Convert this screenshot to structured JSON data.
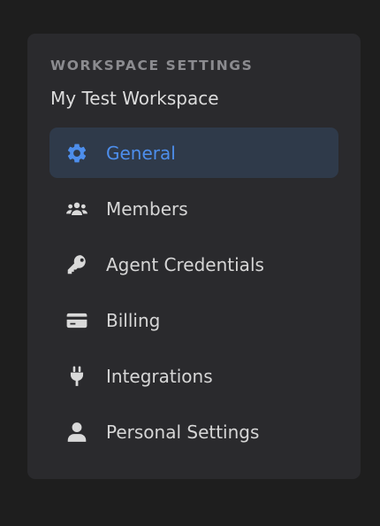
{
  "sidebar": {
    "section_label": "WORKSPACE SETTINGS",
    "workspace_name": "My Test Workspace",
    "items": [
      {
        "label": "General",
        "icon": "gear-icon",
        "active": true
      },
      {
        "label": "Members",
        "icon": "users-icon",
        "active": false
      },
      {
        "label": "Agent Credentials",
        "icon": "key-icon",
        "active": false
      },
      {
        "label": "Billing",
        "icon": "credit-card-icon",
        "active": false
      },
      {
        "label": "Integrations",
        "icon": "plug-icon",
        "active": false
      },
      {
        "label": "Personal Settings",
        "icon": "user-icon",
        "active": false
      }
    ]
  },
  "colors": {
    "background": "#1e1e1e",
    "panel": "#2a2a2d",
    "active_background": "#2f3a4a",
    "accent": "#4d8eec",
    "text": "#d6d6d6",
    "muted": "#8b8b8f"
  }
}
